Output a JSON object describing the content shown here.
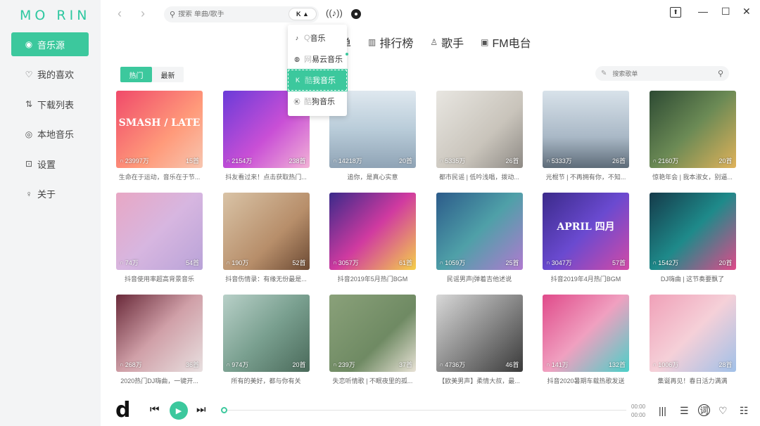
{
  "app": {
    "logo": "MO RIN"
  },
  "sidebar": {
    "items": [
      {
        "label": "音乐源",
        "icon": "source-icon",
        "glyph": "◉",
        "active": true
      },
      {
        "label": "我的喜欢",
        "icon": "heart-icon",
        "glyph": "♡"
      },
      {
        "label": "下载列表",
        "icon": "download-sort-icon",
        "glyph": "⇅"
      },
      {
        "label": "本地音乐",
        "icon": "local-play-icon",
        "glyph": "◎"
      },
      {
        "label": "设置",
        "icon": "settings-icon",
        "glyph": "⊡"
      },
      {
        "label": "关于",
        "icon": "bulb-icon",
        "glyph": "♀"
      }
    ]
  },
  "topbar": {
    "search_placeholder": "搜索 单曲/歌手",
    "source_toggle": "K ▲"
  },
  "categories": [
    {
      "label": "单",
      "icon": ""
    },
    {
      "label": "排行榜",
      "icon": "chart-icon",
      "glyph": "▥"
    },
    {
      "label": "歌手",
      "icon": "singer-icon",
      "glyph": "♙"
    },
    {
      "label": "FM电台",
      "icon": "radio-icon",
      "glyph": "▣"
    }
  ],
  "filters": [
    {
      "label": "热门",
      "active": true
    },
    {
      "label": "最新",
      "active": false
    }
  ],
  "song_search_placeholder": "搜索歌单",
  "dropdown": {
    "items": [
      {
        "prefix": "Q",
        "label": "音乐",
        "glyph": "♪",
        "icon": "qq-music-icon"
      },
      {
        "prefix": "网",
        "label": "易云音乐",
        "glyph": "◍",
        "icon": "netease-icon"
      },
      {
        "prefix": "酷",
        "label": "我音乐",
        "glyph": "K",
        "icon": "kuwo-icon",
        "active": true
      },
      {
        "prefix": "酷",
        "label": "狗音乐",
        "glyph": "Ⓚ",
        "icon": "kugou-icon"
      }
    ]
  },
  "playlists": [
    {
      "plays": "23997万",
      "count": "15首",
      "title": "生命在于运动，音乐在于节...",
      "bg": "linear-gradient(135deg,#f04a6a,#ff9a7a 60%,#f7c6b0)",
      "overlay": "SMASH / LATE"
    },
    {
      "plays": "2154万",
      "count": "238首",
      "title": "抖友看过来！点击获取热门...",
      "bg": "linear-gradient(135deg,#6a3bd8,#c94fd6 55%,#f2b3d6)",
      "overlay": ""
    },
    {
      "plays": "14218万",
      "count": "20首",
      "title": "追你，是真心实意",
      "bg": "linear-gradient(180deg,#dfe8ef,#b9ccd9 50%,#8fa3b5)",
      "overlay": ""
    },
    {
      "plays": "5335万",
      "count": "26首",
      "title": "都市民谣 | 低吟浅唱，拨动...",
      "bg": "linear-gradient(135deg,#e8e6e1,#c9c4bb 60%,#8e8a85)",
      "overlay": ""
    },
    {
      "plays": "5333万",
      "count": "26首",
      "title": "光棍节 | 不再拥有你，不知...",
      "bg": "linear-gradient(180deg,#d8e2ea,#a9b8c6 60%,#5d6b78)",
      "overlay": ""
    },
    {
      "plays": "2160万",
      "count": "20首",
      "title": "惊艳年会 | 我本淑女，别逼...",
      "bg": "linear-gradient(135deg,#2d4a33,#6b8a55 50%,#e0b25a)",
      "overlay": ""
    },
    {
      "plays": "74万",
      "count": "54首",
      "title": "抖音使用率超高背景音乐",
      "bg": "linear-gradient(135deg,#e8a7c4,#d7b6e0 50%,#b9a3d8)",
      "overlay": ""
    },
    {
      "plays": "190万",
      "count": "52首",
      "title": "抖音伤情录：有缘无份最是...",
      "bg": "linear-gradient(135deg,#d9c3a6,#b78e6a 60%,#6c4a34)",
      "overlay": ""
    },
    {
      "plays": "3057万",
      "count": "61首",
      "title": "抖音2019年5月热门BGM",
      "bg": "linear-gradient(135deg,#3a2a8a,#d03aa0 50%,#f5d04a)",
      "overlay": ""
    },
    {
      "plays": "1059万",
      "count": "25首",
      "title": "民谣男声|弹着吉他述说",
      "bg": "linear-gradient(135deg,#2c5b8a,#4fa0a8 50%,#b07ad0)",
      "overlay": ""
    },
    {
      "plays": "3047万",
      "count": "57首",
      "title": "抖音2019年4月热门BGM",
      "bg": "linear-gradient(135deg,#3b2a8a,#6a4ad0 50%,#d24aa6)",
      "overlay": "APRIL 四月"
    },
    {
      "plays": "1542万",
      "count": "20首",
      "title": "DJ嗨曲 | 这节奏要飘了",
      "bg": "linear-gradient(135deg,#153a4a,#1e8a8a 50%,#e04a8a)",
      "overlay": ""
    },
    {
      "plays": "268万",
      "count": "36首",
      "title": "2020热门DJ嗨曲，一键开...",
      "bg": "linear-gradient(135deg,#6a2a3a,#d0a0a8 50%,#e8e0e0)",
      "overlay": ""
    },
    {
      "plays": "974万",
      "count": "20首",
      "title": "所有的美好，都与你有关",
      "bg": "linear-gradient(135deg,#b8d0c8,#7aa090 50%,#4a6a5a)",
      "overlay": ""
    },
    {
      "plays": "239万",
      "count": "37首",
      "title": "失恋听情歌 | 不眠夜里的孤...",
      "bg": "linear-gradient(135deg,#8aa17a,#6f8a63 60%,#e8e2d6)",
      "overlay": ""
    },
    {
      "plays": "4736万",
      "count": "46首",
      "title": "【欧美男声】柔情大叔，最...",
      "bg": "linear-gradient(135deg,#d8d8d8,#8a8a8a 50%,#3a3a3a)",
      "overlay": ""
    },
    {
      "plays": "141万",
      "count": "132首",
      "title": "抖音2020暑期车载热歌发送",
      "bg": "linear-gradient(135deg,#e04a8a,#f0a0c0 50%,#4ad0c8)",
      "overlay": ""
    },
    {
      "plays": "1006万",
      "count": "28首",
      "title": "集诞再见！春日活力满满",
      "bg": "linear-gradient(135deg,#f0a0b8,#f5d0d8 50%,#a0c0e8)",
      "overlay": ""
    }
  ],
  "player": {
    "logo": "d",
    "time_current": "00:00",
    "time_total": "00:00"
  },
  "colors": {
    "accent": "#3cc89d"
  }
}
